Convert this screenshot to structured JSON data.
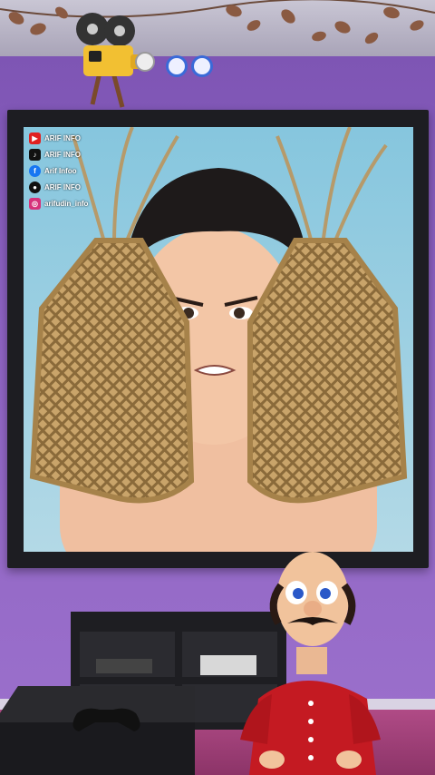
{
  "social_overlay": {
    "items": [
      {
        "icon": "youtube-icon",
        "color": "#e02020",
        "label": "ARIF INFO"
      },
      {
        "icon": "tiktok-icon",
        "color": "#111111",
        "label": "ARIF INFO"
      },
      {
        "icon": "facebook-icon",
        "color": "#1877f2",
        "label": "Arif Infoo"
      },
      {
        "icon": "snapchat-icon",
        "color": "#111111",
        "label": "ARIF INFO"
      },
      {
        "icon": "instagram-icon",
        "color": "#d6317a",
        "label": "arifudin_info"
      }
    ]
  },
  "colors": {
    "wall": "#8a5fb8",
    "floor": "#a8437e",
    "frame": "#1d1d22",
    "shirt": "#c41a22"
  },
  "icons": {
    "projector": "projector-icon",
    "carousel_dots": [
      "indicator-dot",
      "indicator-dot"
    ]
  }
}
